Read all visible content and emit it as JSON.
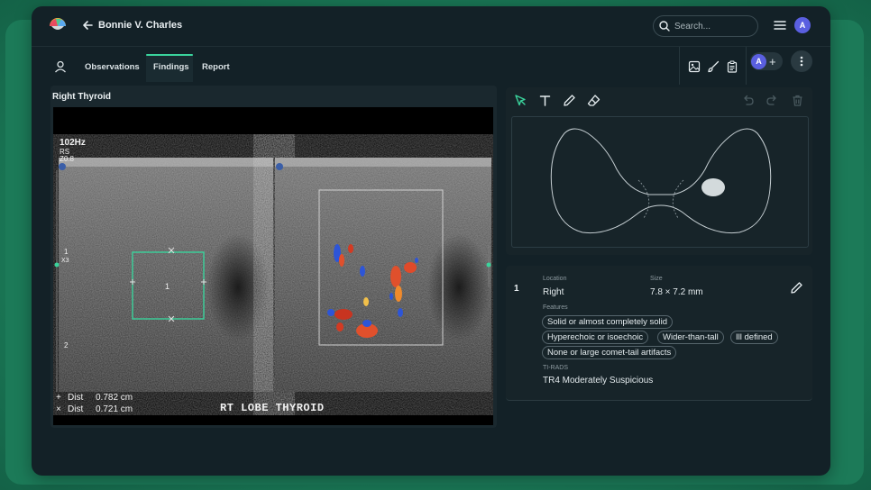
{
  "header": {
    "patient_name": "Bonnie V. Charles",
    "search_placeholder": "Search...",
    "user_initial": "A"
  },
  "tabs": [
    {
      "label": "Observations",
      "active": false
    },
    {
      "label": "Findings",
      "active": true
    },
    {
      "label": "Report",
      "active": false
    }
  ],
  "toolbar": {
    "icons": [
      "image-icon",
      "brush-icon",
      "clipboard-icon"
    ],
    "collaborator_initial": "A",
    "add_label": "+"
  },
  "image_panel": {
    "title": "Right Thyroid",
    "overlay": {
      "freq": "102Hz",
      "rs": "RS",
      "zoom": "Z0.8",
      "marker_top": "1",
      "marker_x3": "X3",
      "marker_bottom": "2",
      "nodule_label": "1",
      "dist1_label": "Dist",
      "dist1_value": "0.782 cm",
      "dist2_label": "Dist",
      "dist2_value": "0.721 cm",
      "caption": "RT LOBE THYROID"
    }
  },
  "draw_tools": [
    "select-arrow-icon",
    "text-icon",
    "pen-icon",
    "eraser-icon"
  ],
  "history_tools": [
    "undo-icon",
    "redo-icon",
    "trash-icon"
  ],
  "finding": {
    "number": "1",
    "location_label": "Location",
    "location_value": "Right",
    "size_label": "Size",
    "size_value": "7.8 × 7.2 mm",
    "features_label": "Features",
    "features": [
      "Solid or almost completely solid",
      "Hyperechoic or isoechoic",
      "Wider-than-tall",
      "Ill defined",
      "None or large comet-tail artifacts"
    ],
    "tirads_label": "TI-RADS",
    "tirads_value": "TR4 Moderately Suspicious"
  },
  "colors": {
    "accent": "#3ad39c",
    "app_bg": "#132127",
    "outer_bg": "#1f8a64",
    "avatar": "#5a5fe0"
  }
}
